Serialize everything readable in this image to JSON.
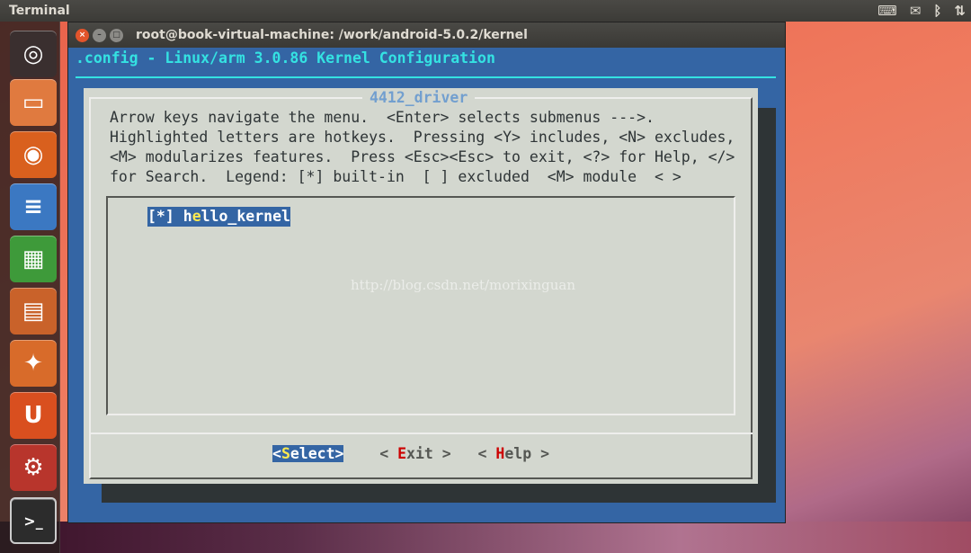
{
  "topbar": {
    "app_name": "Terminal"
  },
  "tray": [
    "keyboard-icon",
    "mail-icon",
    "bluetooth-icon",
    "network-icon"
  ],
  "launcher": [
    "ubuntu-dash",
    "files",
    "firefox",
    "libreoffice-writer",
    "libreoffice-calc",
    "libreoffice-impress",
    "software-center",
    "ubuntu-one",
    "system-settings",
    "terminal"
  ],
  "window": {
    "title": "root@book-virtual-machine: /work/android-5.0.2/kernel"
  },
  "menuconfig": {
    "header": ".config - Linux/arm 3.0.86 Kernel Configuration",
    "dialog_title": "4412_driver",
    "help_lines": [
      "Arrow keys navigate the menu.  <Enter> selects submenus --->.",
      "Highlighted letters are hotkeys.  Pressing <Y> includes, <N> excludes,",
      "<M> modularizes features.  Press <Esc><Esc> to exit, <?> for Help, </>",
      "for Search.  Legend: [*] built-in  [ ] excluded  <M> module  < >"
    ],
    "items": [
      {
        "state": "[*]",
        "label_pre": "h",
        "label_hot": "e",
        "label_post": "llo_kernel"
      }
    ],
    "buttons": {
      "select": {
        "pre": "<",
        "hot": "S",
        "post": "elect>"
      },
      "exit": {
        "pre": "< ",
        "hot": "E",
        "post": "xit >"
      },
      "help": {
        "pre": "< ",
        "hot": "H",
        "post": "elp >"
      }
    }
  },
  "watermark": "http://blog.csdn.net/morixinguan"
}
